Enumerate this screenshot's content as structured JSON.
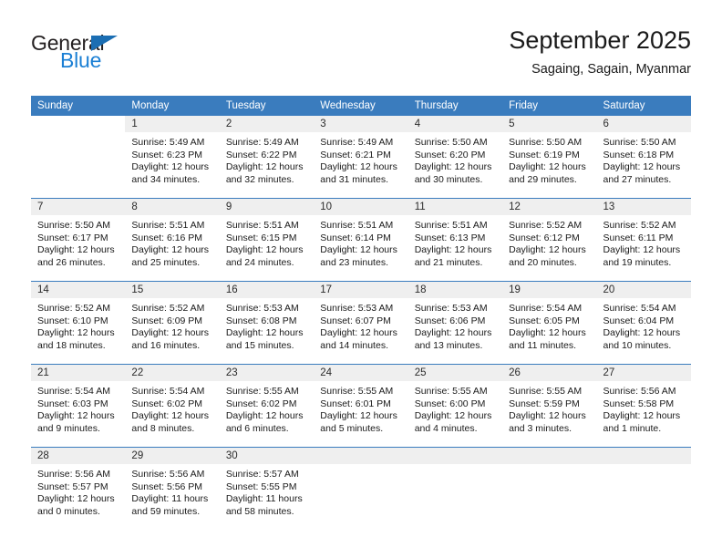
{
  "brand": {
    "name_top": "General",
    "name_bottom": "Blue"
  },
  "header": {
    "title": "September 2025",
    "location": "Sagaing, Sagain, Myanmar"
  },
  "weekday_headers": [
    "Sunday",
    "Monday",
    "Tuesday",
    "Wednesday",
    "Thursday",
    "Friday",
    "Saturday"
  ],
  "colors": {
    "header_blue": "#3a7cbe",
    "brand_blue": "#1b7fd4",
    "daynum_band": "#efefef"
  },
  "weeks": [
    [
      {
        "empty": true
      },
      {
        "day": "1",
        "sunrise": "Sunrise: 5:49 AM",
        "sunset": "Sunset: 6:23 PM",
        "daylight1": "Daylight: 12 hours",
        "daylight2": "and 34 minutes."
      },
      {
        "day": "2",
        "sunrise": "Sunrise: 5:49 AM",
        "sunset": "Sunset: 6:22 PM",
        "daylight1": "Daylight: 12 hours",
        "daylight2": "and 32 minutes."
      },
      {
        "day": "3",
        "sunrise": "Sunrise: 5:49 AM",
        "sunset": "Sunset: 6:21 PM",
        "daylight1": "Daylight: 12 hours",
        "daylight2": "and 31 minutes."
      },
      {
        "day": "4",
        "sunrise": "Sunrise: 5:50 AM",
        "sunset": "Sunset: 6:20 PM",
        "daylight1": "Daylight: 12 hours",
        "daylight2": "and 30 minutes."
      },
      {
        "day": "5",
        "sunrise": "Sunrise: 5:50 AM",
        "sunset": "Sunset: 6:19 PM",
        "daylight1": "Daylight: 12 hours",
        "daylight2": "and 29 minutes."
      },
      {
        "day": "6",
        "sunrise": "Sunrise: 5:50 AM",
        "sunset": "Sunset: 6:18 PM",
        "daylight1": "Daylight: 12 hours",
        "daylight2": "and 27 minutes."
      }
    ],
    [
      {
        "day": "7",
        "sunrise": "Sunrise: 5:50 AM",
        "sunset": "Sunset: 6:17 PM",
        "daylight1": "Daylight: 12 hours",
        "daylight2": "and 26 minutes."
      },
      {
        "day": "8",
        "sunrise": "Sunrise: 5:51 AM",
        "sunset": "Sunset: 6:16 PM",
        "daylight1": "Daylight: 12 hours",
        "daylight2": "and 25 minutes."
      },
      {
        "day": "9",
        "sunrise": "Sunrise: 5:51 AM",
        "sunset": "Sunset: 6:15 PM",
        "daylight1": "Daylight: 12 hours",
        "daylight2": "and 24 minutes."
      },
      {
        "day": "10",
        "sunrise": "Sunrise: 5:51 AM",
        "sunset": "Sunset: 6:14 PM",
        "daylight1": "Daylight: 12 hours",
        "daylight2": "and 23 minutes."
      },
      {
        "day": "11",
        "sunrise": "Sunrise: 5:51 AM",
        "sunset": "Sunset: 6:13 PM",
        "daylight1": "Daylight: 12 hours",
        "daylight2": "and 21 minutes."
      },
      {
        "day": "12",
        "sunrise": "Sunrise: 5:52 AM",
        "sunset": "Sunset: 6:12 PM",
        "daylight1": "Daylight: 12 hours",
        "daylight2": "and 20 minutes."
      },
      {
        "day": "13",
        "sunrise": "Sunrise: 5:52 AM",
        "sunset": "Sunset: 6:11 PM",
        "daylight1": "Daylight: 12 hours",
        "daylight2": "and 19 minutes."
      }
    ],
    [
      {
        "day": "14",
        "sunrise": "Sunrise: 5:52 AM",
        "sunset": "Sunset: 6:10 PM",
        "daylight1": "Daylight: 12 hours",
        "daylight2": "and 18 minutes."
      },
      {
        "day": "15",
        "sunrise": "Sunrise: 5:52 AM",
        "sunset": "Sunset: 6:09 PM",
        "daylight1": "Daylight: 12 hours",
        "daylight2": "and 16 minutes."
      },
      {
        "day": "16",
        "sunrise": "Sunrise: 5:53 AM",
        "sunset": "Sunset: 6:08 PM",
        "daylight1": "Daylight: 12 hours",
        "daylight2": "and 15 minutes."
      },
      {
        "day": "17",
        "sunrise": "Sunrise: 5:53 AM",
        "sunset": "Sunset: 6:07 PM",
        "daylight1": "Daylight: 12 hours",
        "daylight2": "and 14 minutes."
      },
      {
        "day": "18",
        "sunrise": "Sunrise: 5:53 AM",
        "sunset": "Sunset: 6:06 PM",
        "daylight1": "Daylight: 12 hours",
        "daylight2": "and 13 minutes."
      },
      {
        "day": "19",
        "sunrise": "Sunrise: 5:54 AM",
        "sunset": "Sunset: 6:05 PM",
        "daylight1": "Daylight: 12 hours",
        "daylight2": "and 11 minutes."
      },
      {
        "day": "20",
        "sunrise": "Sunrise: 5:54 AM",
        "sunset": "Sunset: 6:04 PM",
        "daylight1": "Daylight: 12 hours",
        "daylight2": "and 10 minutes."
      }
    ],
    [
      {
        "day": "21",
        "sunrise": "Sunrise: 5:54 AM",
        "sunset": "Sunset: 6:03 PM",
        "daylight1": "Daylight: 12 hours",
        "daylight2": "and 9 minutes."
      },
      {
        "day": "22",
        "sunrise": "Sunrise: 5:54 AM",
        "sunset": "Sunset: 6:02 PM",
        "daylight1": "Daylight: 12 hours",
        "daylight2": "and 8 minutes."
      },
      {
        "day": "23",
        "sunrise": "Sunrise: 5:55 AM",
        "sunset": "Sunset: 6:02 PM",
        "daylight1": "Daylight: 12 hours",
        "daylight2": "and 6 minutes."
      },
      {
        "day": "24",
        "sunrise": "Sunrise: 5:55 AM",
        "sunset": "Sunset: 6:01 PM",
        "daylight1": "Daylight: 12 hours",
        "daylight2": "and 5 minutes."
      },
      {
        "day": "25",
        "sunrise": "Sunrise: 5:55 AM",
        "sunset": "Sunset: 6:00 PM",
        "daylight1": "Daylight: 12 hours",
        "daylight2": "and 4 minutes."
      },
      {
        "day": "26",
        "sunrise": "Sunrise: 5:55 AM",
        "sunset": "Sunset: 5:59 PM",
        "daylight1": "Daylight: 12 hours",
        "daylight2": "and 3 minutes."
      },
      {
        "day": "27",
        "sunrise": "Sunrise: 5:56 AM",
        "sunset": "Sunset: 5:58 PM",
        "daylight1": "Daylight: 12 hours",
        "daylight2": "and 1 minute."
      }
    ],
    [
      {
        "day": "28",
        "sunrise": "Sunrise: 5:56 AM",
        "sunset": "Sunset: 5:57 PM",
        "daylight1": "Daylight: 12 hours",
        "daylight2": "and 0 minutes."
      },
      {
        "day": "29",
        "sunrise": "Sunrise: 5:56 AM",
        "sunset": "Sunset: 5:56 PM",
        "daylight1": "Daylight: 11 hours",
        "daylight2": "and 59 minutes."
      },
      {
        "day": "30",
        "sunrise": "Sunrise: 5:57 AM",
        "sunset": "Sunset: 5:55 PM",
        "daylight1": "Daylight: 11 hours",
        "daylight2": "and 58 minutes."
      },
      {
        "blank": true
      },
      {
        "blank": true
      },
      {
        "blank": true
      },
      {
        "blank": true
      }
    ]
  ]
}
